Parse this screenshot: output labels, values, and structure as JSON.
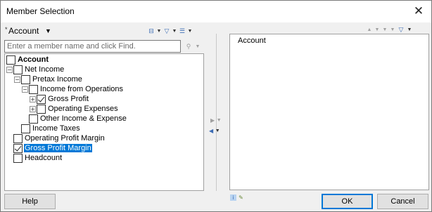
{
  "window": {
    "title": "Member Selection",
    "close_icon": "✕"
  },
  "dimension": {
    "required_marker": "*",
    "label": "Account"
  },
  "search": {
    "placeholder": "Enter a member name and click Find."
  },
  "tree": [
    {
      "label": "Account",
      "level": 0,
      "expander": "none",
      "checked": false,
      "bold": true,
      "selected": false
    },
    {
      "label": "Net Income",
      "level": 0,
      "expander": "minus",
      "checked": false,
      "bold": false,
      "selected": false
    },
    {
      "label": "Pretax Income",
      "level": 1,
      "expander": "minus",
      "checked": false,
      "bold": false,
      "selected": false
    },
    {
      "label": "Income from Operations",
      "level": 2,
      "expander": "minus",
      "checked": false,
      "bold": false,
      "selected": false
    },
    {
      "label": "Gross Profit",
      "level": 3,
      "expander": "plus",
      "checked": true,
      "bold": false,
      "selected": false
    },
    {
      "label": "Operating Expenses",
      "level": 3,
      "expander": "plus",
      "checked": false,
      "bold": false,
      "selected": false
    },
    {
      "label": "Other Income & Expense",
      "level": 2,
      "expander": "none",
      "checked": false,
      "bold": false,
      "selected": false
    },
    {
      "label": "Income Taxes",
      "level": 1,
      "expander": "none",
      "checked": false,
      "bold": false,
      "selected": false
    },
    {
      "label": "Operating Profit Margin",
      "level": 0,
      "expander": "none",
      "checked": false,
      "bold": false,
      "selected": false
    },
    {
      "label": "Gross Profit Margin",
      "level": 0,
      "expander": "none",
      "checked": true,
      "bold": false,
      "selected": true
    },
    {
      "label": "Headcount",
      "level": 0,
      "expander": "none",
      "checked": false,
      "bold": false,
      "selected": false
    }
  ],
  "selected_members": [
    "Account"
  ],
  "buttons": {
    "help": "Help",
    "ok": "OK",
    "cancel": "Cancel"
  },
  "colors": {
    "selection": "#0078d7",
    "accent_icon": "#3c6cb4"
  }
}
